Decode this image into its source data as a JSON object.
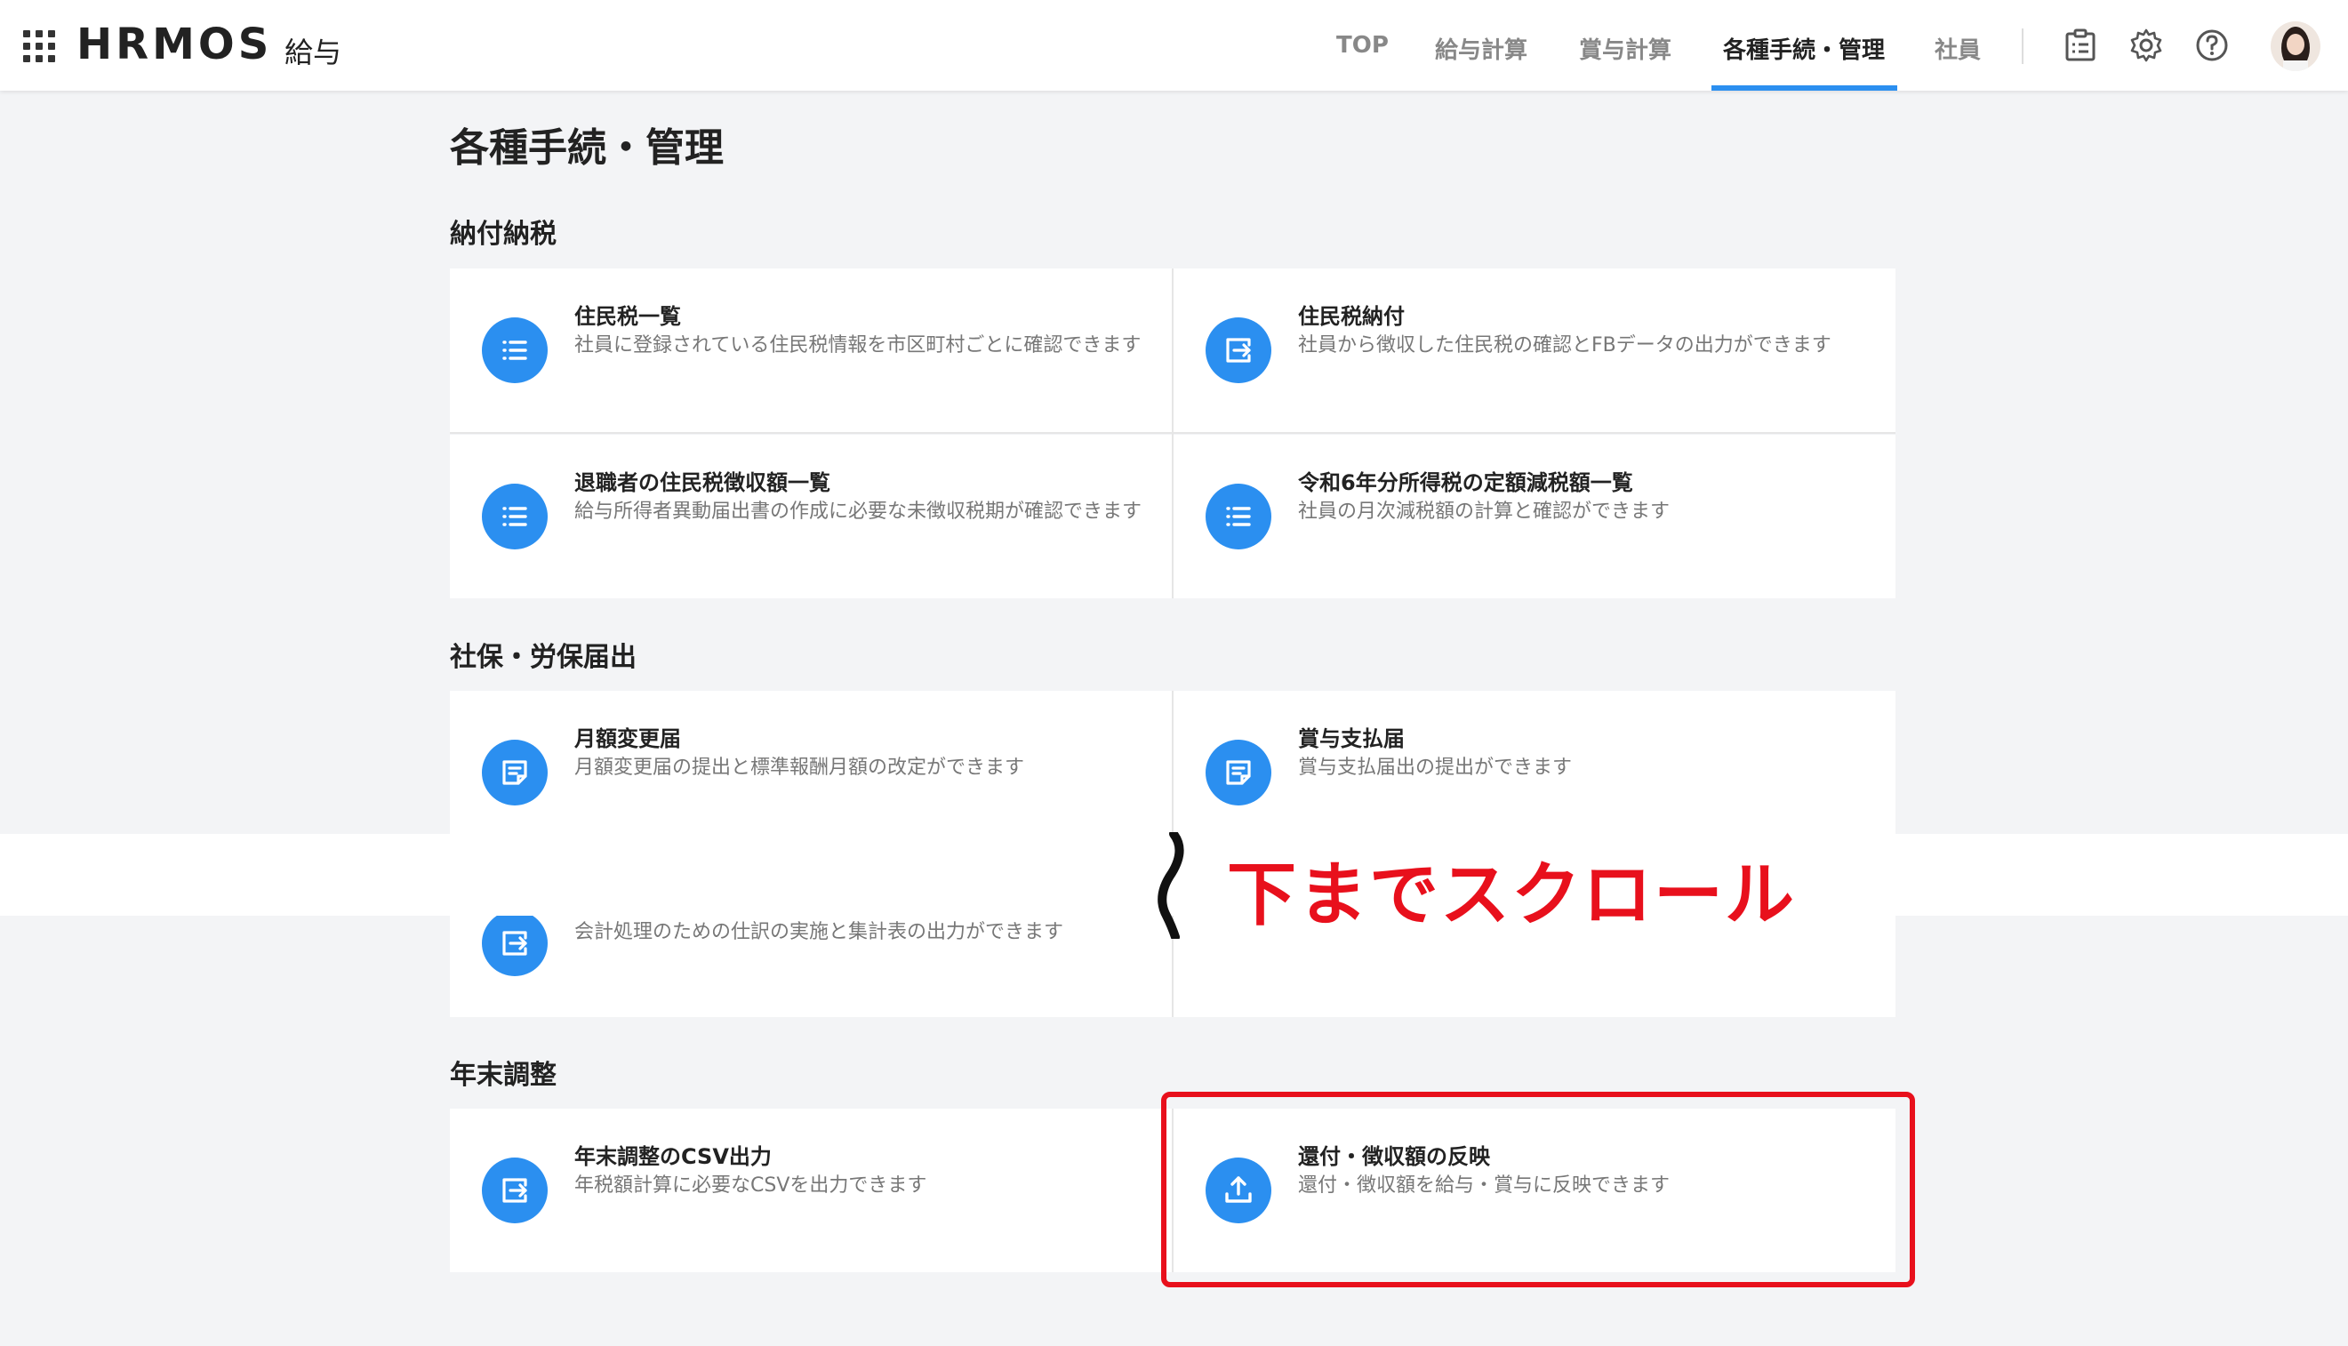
{
  "header": {
    "brand": "HRMOS",
    "product": "給与",
    "nav": [
      {
        "label": "TOP",
        "active": false
      },
      {
        "label": "給与計算",
        "active": false
      },
      {
        "label": "賞与計算",
        "active": false
      },
      {
        "label": "各種手続・管理",
        "active": true
      },
      {
        "label": "社員",
        "active": false
      }
    ],
    "icons": [
      "task-list-icon",
      "gear-icon",
      "help-icon"
    ],
    "accent_color": "#2b8ff0"
  },
  "page": {
    "title": "各種手続・管理"
  },
  "sections": [
    {
      "title": "納付納税",
      "cards": [
        {
          "title": "住民税一覧",
          "desc": "社員に登録されている住民税情報を市区町村ごとに確認できます",
          "icon": "list-icon"
        },
        {
          "title": "住民税納付",
          "desc": "社員から徴収した住民税の確認とFBデータの出力ができます",
          "icon": "export-icon"
        },
        {
          "title": "退職者の住民税徴収額一覧",
          "desc": "給与所得者異動届出書の作成に必要な未徴収税期が確認できます",
          "icon": "list-icon"
        },
        {
          "title": "令和6年分所得税の定額減税額一覧",
          "desc": "社員の月次減税額の計算と確認ができます",
          "icon": "list-icon"
        }
      ]
    },
    {
      "title": "社保・労保届出",
      "cards": [
        {
          "title": "月額変更届",
          "desc": "月額変更届の提出と標準報酬月額の改定ができます",
          "icon": "document-icon"
        },
        {
          "title": "賞与支払届",
          "desc": "賞与支払届出の提出ができます",
          "icon": "document-icon"
        },
        {
          "title": "",
          "desc": "会計処理のための仕訳の実施と集計表の出力ができます",
          "icon": "export-icon"
        }
      ]
    },
    {
      "title": "年末調整",
      "cards": [
        {
          "title": "年末調整のCSV出力",
          "desc": "年税額計算に必要なCSVを出力できます",
          "icon": "export-icon"
        },
        {
          "title": "還付・徴収額の反映",
          "desc": "還付・徴収額を給与・賞与に反映できます",
          "icon": "upload-icon"
        }
      ]
    }
  ],
  "annotation": {
    "scroll_text": "下までスクロール",
    "color": "#e8101c"
  }
}
